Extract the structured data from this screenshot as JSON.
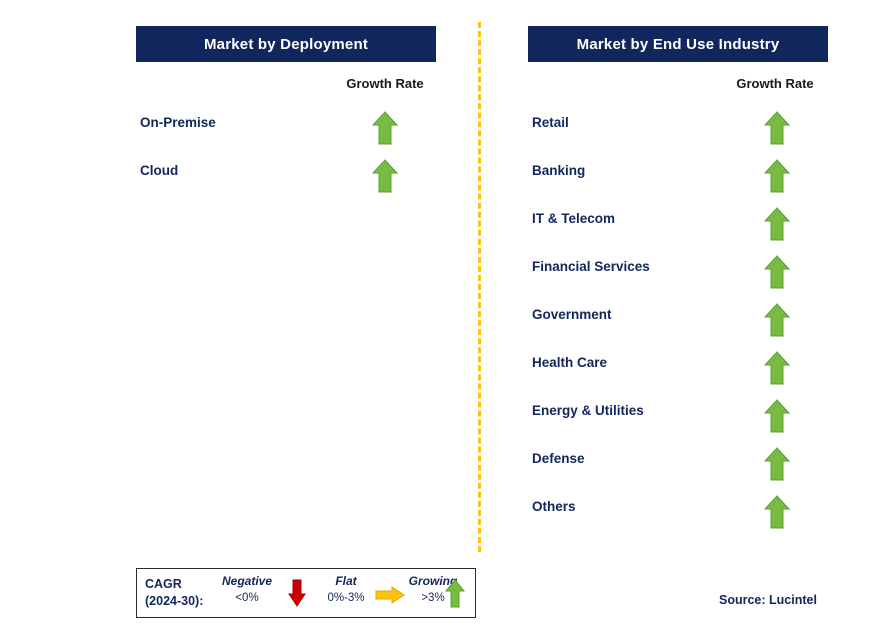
{
  "panels": [
    {
      "title": "Market by Deployment",
      "growth_rate_label": "Growth Rate",
      "rows": [
        {
          "label": "On-Premise",
          "trend": "growing-up-arrow-icon"
        },
        {
          "label": "Cloud",
          "trend": "growing-up-arrow-icon"
        }
      ]
    },
    {
      "title": "Market by End Use Industry",
      "growth_rate_label": "Growth Rate",
      "rows": [
        {
          "label": "Retail",
          "trend": "growing-up-arrow-icon"
        },
        {
          "label": "Banking",
          "trend": "growing-up-arrow-icon"
        },
        {
          "label": "IT & Telecom",
          "trend": "growing-up-arrow-icon"
        },
        {
          "label": "Financial Services",
          "trend": "growing-up-arrow-icon"
        },
        {
          "label": "Government",
          "trend": "growing-up-arrow-icon"
        },
        {
          "label": "Health Care",
          "trend": "growing-up-arrow-icon"
        },
        {
          "label": "Energy & Utilities",
          "trend": "growing-up-arrow-icon"
        },
        {
          "label": "Defense",
          "trend": "growing-up-arrow-icon"
        },
        {
          "label": "Others",
          "trend": "growing-up-arrow-icon"
        }
      ]
    }
  ],
  "legend": {
    "cagr_line1": "CAGR",
    "cagr_line2": "(2024-30):",
    "items": [
      {
        "title": "Negative",
        "range": "<0%",
        "icon": "down-arrow-icon",
        "color": "#cc0000"
      },
      {
        "title": "Flat",
        "range": "0%-3%",
        "icon": "right-arrow-icon",
        "color": "#ffc20e"
      },
      {
        "title": "Growing",
        "range": ">3%",
        "icon": "up-arrow-icon",
        "color": "#76bc43"
      }
    ]
  },
  "source": "Source: Lucintel",
  "colors": {
    "header_bg": "#12265e",
    "text_navy": "#12265e",
    "green": "#76bc43",
    "green_dark": "#5aa12f",
    "yellow": "#ffc20e",
    "red": "#cc0000"
  }
}
